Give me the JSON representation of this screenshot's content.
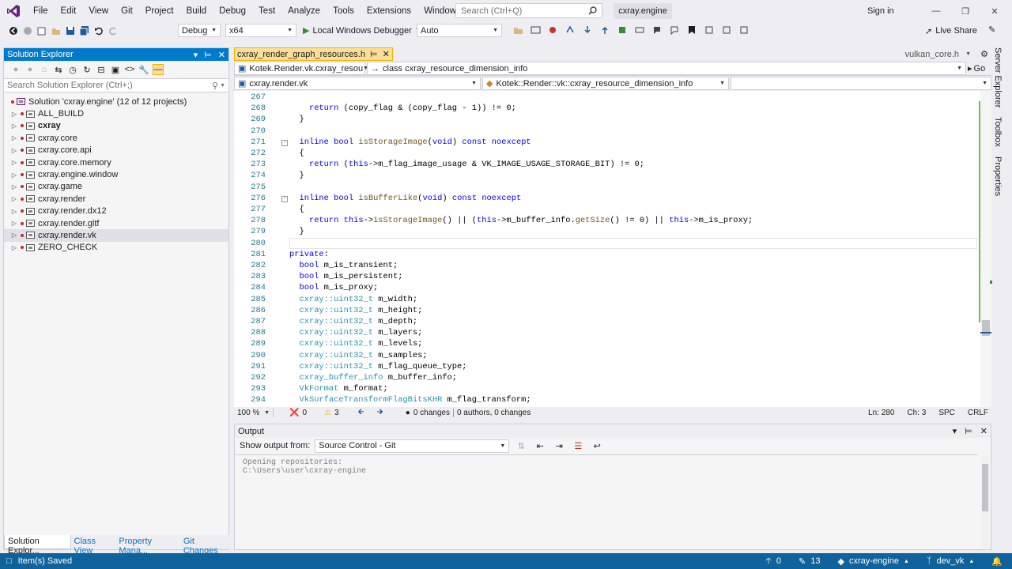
{
  "colors": {
    "accent": "#007acc",
    "active_tab": "#fbde9b",
    "status_bar": "#0e639c",
    "vs_purple": "#68217a"
  },
  "menu": [
    "File",
    "Edit",
    "View",
    "Git",
    "Project",
    "Build",
    "Debug",
    "Test",
    "Analyze",
    "Tools",
    "Extensions",
    "Window",
    "Help"
  ],
  "search": {
    "placeholder": "Search (Ctrl+Q)"
  },
  "solution_name": "cxray.engine",
  "signin": "Sign in",
  "toolbar": {
    "config": "Debug",
    "platform": "x64",
    "debugger": "Local Windows Debugger",
    "auto": "Auto",
    "live_share": "Live Share"
  },
  "solution_explorer": {
    "title": "Solution Explorer",
    "search_placeholder": "Search Solution Explorer (Ctrl+;)",
    "root": "Solution 'cxray.engine' (12 of 12 projects)",
    "items": [
      {
        "label": "ALL_BUILD",
        "bold": false,
        "selected": false
      },
      {
        "label": "cxray",
        "bold": true,
        "selected": false
      },
      {
        "label": "cxray.core",
        "bold": false,
        "selected": false
      },
      {
        "label": "cxray.core.api",
        "bold": false,
        "selected": false
      },
      {
        "label": "cxray.core.memory",
        "bold": false,
        "selected": false
      },
      {
        "label": "cxray.engine.window",
        "bold": false,
        "selected": false
      },
      {
        "label": "cxray.game",
        "bold": false,
        "selected": false
      },
      {
        "label": "cxray.render",
        "bold": false,
        "selected": false
      },
      {
        "label": "cxray.render.dx12",
        "bold": false,
        "selected": false
      },
      {
        "label": "cxray.render.gltf",
        "bold": false,
        "selected": false
      },
      {
        "label": "cxray.render.vk",
        "bold": false,
        "selected": true
      },
      {
        "label": "ZERO_CHECK",
        "bold": false,
        "selected": false
      }
    ],
    "tabs": [
      "Solution Explor...",
      "Class View",
      "Property Mana...",
      "Git Changes"
    ]
  },
  "editor": {
    "active_tab": "cxray_render_graph_resources.h",
    "right_tab": "vulkan_core.h",
    "nav_scope": "Kotek.Render.vk.cxray_resou",
    "nav_class": "class cxray_resource_dimension_info",
    "nav_go": "Go",
    "nav_project": "cxray.render.vk",
    "nav_member": "Kotek::Render::vk::cxray_resource_dimension_info",
    "lines": [
      {
        "n": "267",
        "code": "",
        "fold": ""
      },
      {
        "n": "268",
        "code": "    return (copy_flag & (copy_flag - 1)) != 0;",
        "fold": ""
      },
      {
        "n": "269",
        "code": "  }",
        "fold": ""
      },
      {
        "n": "270",
        "code": "",
        "fold": ""
      },
      {
        "n": "271",
        "code": "  inline bool isStorageImage(void) const noexcept",
        "fold": "-"
      },
      {
        "n": "272",
        "code": "  {",
        "fold": ""
      },
      {
        "n": "273",
        "code": "    return (this->m_flag_image_usage & VK_IMAGE_USAGE_STORAGE_BIT) != 0;",
        "fold": ""
      },
      {
        "n": "274",
        "code": "  }",
        "fold": ""
      },
      {
        "n": "275",
        "code": "",
        "fold": ""
      },
      {
        "n": "276",
        "code": "  inline bool isBufferLike(void) const noexcept",
        "fold": "-"
      },
      {
        "n": "277",
        "code": "  {",
        "fold": ""
      },
      {
        "n": "278",
        "code": "    return this->isStorageImage() || (this->m_buffer_info.getSize() != 0) || this->m_is_proxy;",
        "fold": ""
      },
      {
        "n": "279",
        "code": "  }",
        "fold": ""
      },
      {
        "n": "280",
        "code": "",
        "fold": ""
      },
      {
        "n": "281",
        "code": "private:",
        "fold": ""
      },
      {
        "n": "282",
        "code": "  bool m_is_transient;",
        "fold": ""
      },
      {
        "n": "283",
        "code": "  bool m_is_persistent;",
        "fold": ""
      },
      {
        "n": "284",
        "code": "  bool m_is_proxy;",
        "fold": ""
      },
      {
        "n": "285",
        "code": "  cxray::uint32_t m_width;",
        "fold": ""
      },
      {
        "n": "286",
        "code": "  cxray::uint32_t m_height;",
        "fold": ""
      },
      {
        "n": "287",
        "code": "  cxray::uint32_t m_depth;",
        "fold": ""
      },
      {
        "n": "288",
        "code": "  cxray::uint32_t m_layers;",
        "fold": ""
      },
      {
        "n": "289",
        "code": "  cxray::uint32_t m_levels;",
        "fold": ""
      },
      {
        "n": "290",
        "code": "  cxray::uint32_t m_samples;",
        "fold": ""
      },
      {
        "n": "291",
        "code": "  cxray::uint32_t m_flag_queue_type;",
        "fold": ""
      },
      {
        "n": "292",
        "code": "  cxray_buffer_info m_buffer_info;",
        "fold": ""
      },
      {
        "n": "293",
        "code": "  VkFormat m_format;",
        "fold": ""
      },
      {
        "n": "294",
        "code": "  VkSurfaceTransformFlagBitsKHR m_flag_transform;",
        "fold": ""
      }
    ],
    "status": {
      "zoom": "100 %",
      "errors": "0",
      "warnings": "3",
      "changes": "0 changes",
      "authors": "0 authors, 0 changes",
      "line": "Ln: 280",
      "col": "Ch: 3",
      "ws": "SPC",
      "eol": "CRLF"
    }
  },
  "output": {
    "title": "Output",
    "show_from_label": "Show output from:",
    "source": "Source Control - Git",
    "lines": [
      "Opening repositories:",
      "C:\\Users\\user\\cxray-engine"
    ]
  },
  "side_tabs": [
    "Server Explorer",
    "Toolbox",
    "Properties"
  ],
  "statusbar": {
    "message": "Item(s) Saved",
    "up": "0",
    "edits": "13",
    "repo": "cxray-engine",
    "branch": "dev_vk"
  }
}
